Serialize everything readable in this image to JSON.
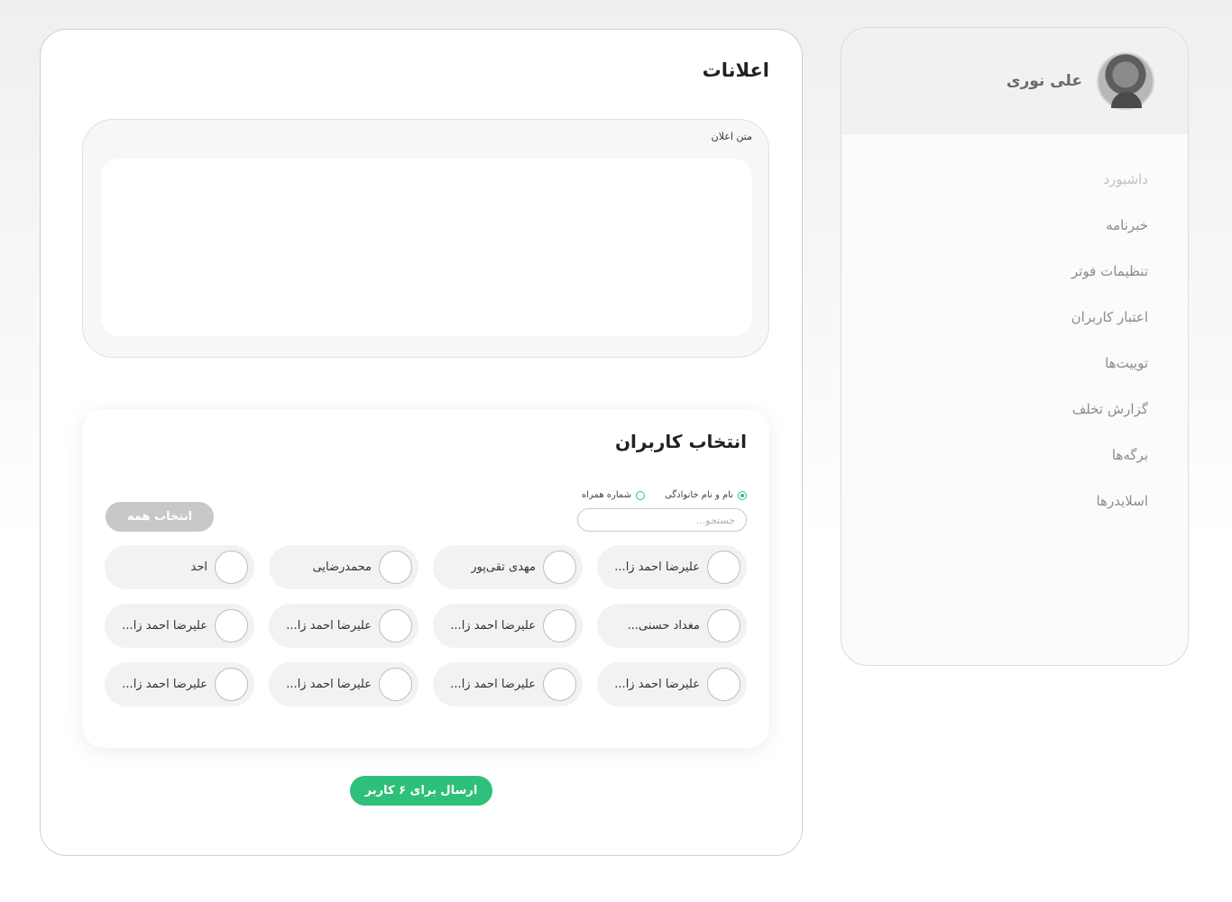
{
  "sidebar": {
    "user_name": "علی نوری",
    "items": [
      {
        "label": "داشبورد",
        "active": true
      },
      {
        "label": "خبرنامه"
      },
      {
        "label": "تنظیمات فوتر"
      },
      {
        "label": "اعتبار کاربران"
      },
      {
        "label": "توییت‌ها"
      },
      {
        "label": "گزارش تخلف"
      },
      {
        "label": "برگه‌ها"
      },
      {
        "label": "اسلایدرها"
      }
    ]
  },
  "main": {
    "title": "اعلانات",
    "announcement_label": "متن اعلان",
    "announcement_text": "",
    "users": {
      "title": "انتخاب کاربران",
      "search_by": [
        {
          "label": "نام و نام خانوادگی",
          "checked": true
        },
        {
          "label": "شماره همراه",
          "checked": false
        }
      ],
      "search_placeholder": "جستجو...",
      "select_all_label": "انتخاب همه",
      "list": [
        "علیرضا احمد زا...",
        "مهدی تقی‌پور",
        "محمدرضایی",
        "احد",
        "مغداد حسنی...",
        "علیرضا احمد زا...",
        "علیرضا احمد زا...",
        "علیرضا احمد زا...",
        "علیرضا احمد زا...",
        "علیرضا احمد زا...",
        "علیرضا احمد زا...",
        "علیرضا احمد زا..."
      ]
    },
    "send_label": "ارسال برای ۶ کاربر"
  },
  "colors": {
    "accent": "#2ec07a",
    "disabled_button": "#c8c8c8"
  }
}
